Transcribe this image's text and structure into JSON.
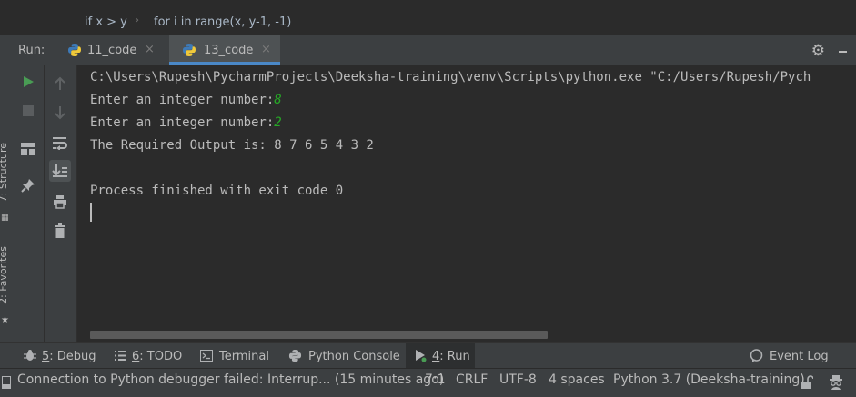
{
  "breadcrumb": {
    "items": [
      "if x > y",
      "for i in range(x, y-1, -1)"
    ],
    "separator": "›"
  },
  "left_strip": {
    "structure_label": "7: Structure",
    "favorites_label": "2: Favorites"
  },
  "run_panel": {
    "label": "Run:",
    "tabs": [
      {
        "label": "11_code",
        "active": false
      },
      {
        "label": "13_code",
        "active": true
      }
    ],
    "close_glyph": "×",
    "icons": {
      "settings": "gear-icon",
      "hide": "minimize-icon"
    }
  },
  "toolbar": {
    "column1": [
      "run-icon",
      "stop-icon",
      "layout-icon",
      "pin-icon"
    ],
    "column2": [
      "up-arrow-icon",
      "down-arrow-icon",
      "soft-wrap-icon",
      "scroll-to-end-icon",
      "print-icon",
      "trash-icon"
    ]
  },
  "console": {
    "lines": [
      {
        "text": "C:\\Users\\Rupesh\\PycharmProjects\\Deeksha-training\\venv\\Scripts\\python.exe \"C:/Users/Rupesh/Pych"
      },
      {
        "text": "Enter an integer number:",
        "input": "8"
      },
      {
        "text": "Enter an integer number:",
        "input": "2"
      },
      {
        "text": "The Required Output is: 8 7 6 5 4 3 2"
      },
      {
        "text": ""
      },
      {
        "text": "Process finished with exit code 0"
      }
    ]
  },
  "tool_windows": {
    "debug": {
      "prefix": "5",
      "rest": ": Debug"
    },
    "todo": {
      "prefix": "6",
      "rest": ": TODO"
    },
    "terminal": {
      "label": "Terminal"
    },
    "python_console": {
      "label": "Python Console"
    },
    "run": {
      "prefix": "4",
      "rest": ": Run"
    },
    "event_log": {
      "label": "Event Log"
    }
  },
  "status_bar": {
    "message": "Connection to Python debugger failed: Interrup... (15 minutes ago)",
    "position": "7:1",
    "line_separator": "CRLF",
    "encoding": "UTF-8",
    "indent": "4 spaces",
    "interpreter": "Python 3.7 (Deeksha-training)"
  },
  "colors": {
    "accent": "#4a88c7",
    "run_green": "#499c54",
    "input_green": "#26a726",
    "background": "#2b2b2b",
    "panel": "#3c3f41"
  }
}
